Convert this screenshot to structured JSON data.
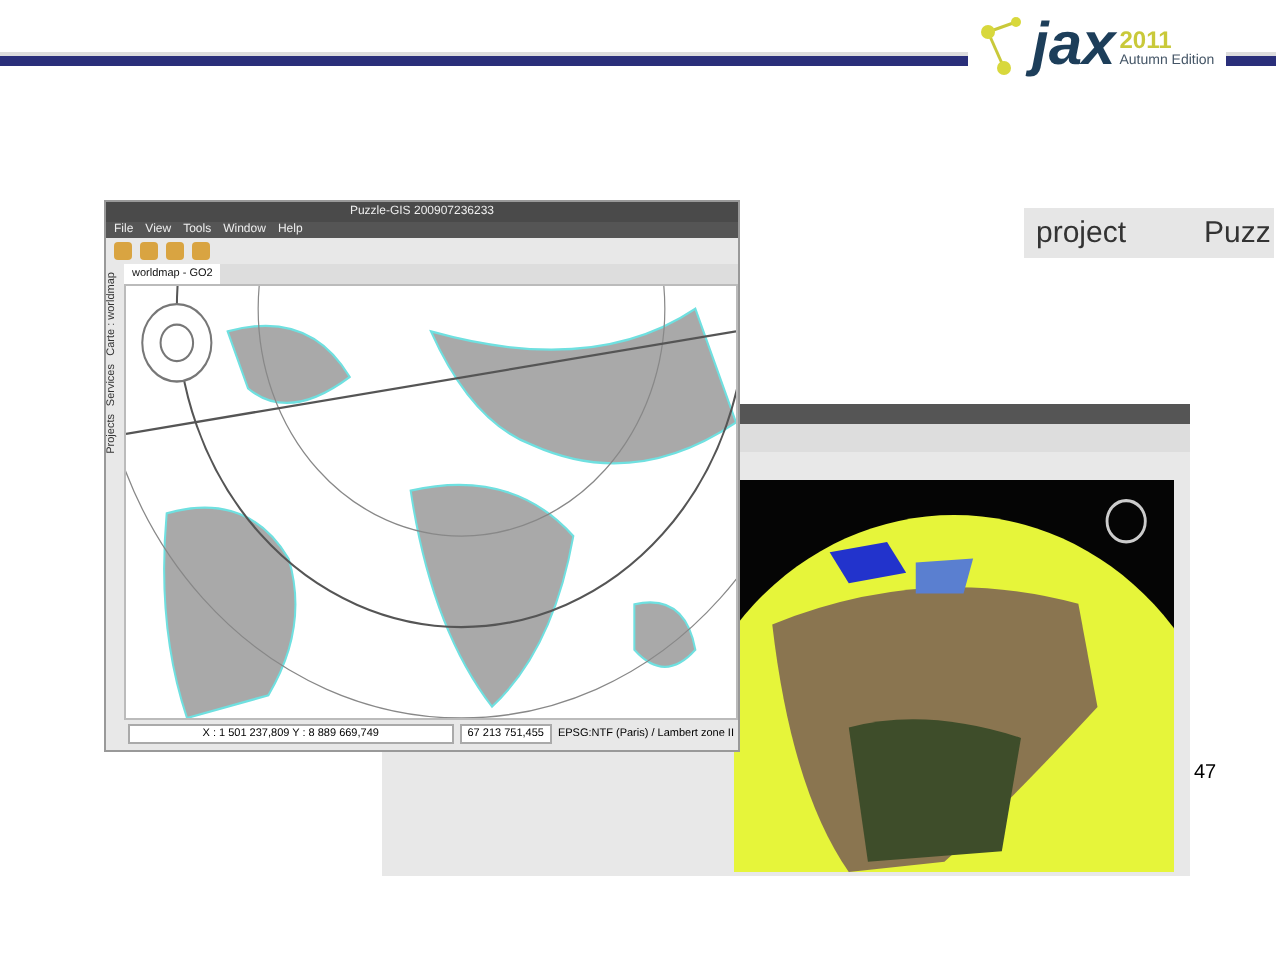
{
  "header": {
    "logo_word": "jax",
    "logo_year": "2011",
    "logo_edition": "Autumn Edition"
  },
  "table": {
    "cells": [
      "project",
      "Puzz"
    ]
  },
  "page_number": "47",
  "gis_window": {
    "title": "Puzzle-GIS 200907236233",
    "menu": [
      "File",
      "View",
      "Tools",
      "Window",
      "Help"
    ],
    "map_tab": {
      "label": "worldmap - GO2",
      "selected": true
    },
    "side_tabs": [
      "Carte : worldmap",
      "Services",
      "Projects"
    ],
    "status": {
      "coordinates": "X : 1 501 237,809   Y : 8 889 669,749",
      "scale": "67 213 751,455",
      "crs": "EPSG:NTF (Paris) / Lambert zone II"
    }
  }
}
